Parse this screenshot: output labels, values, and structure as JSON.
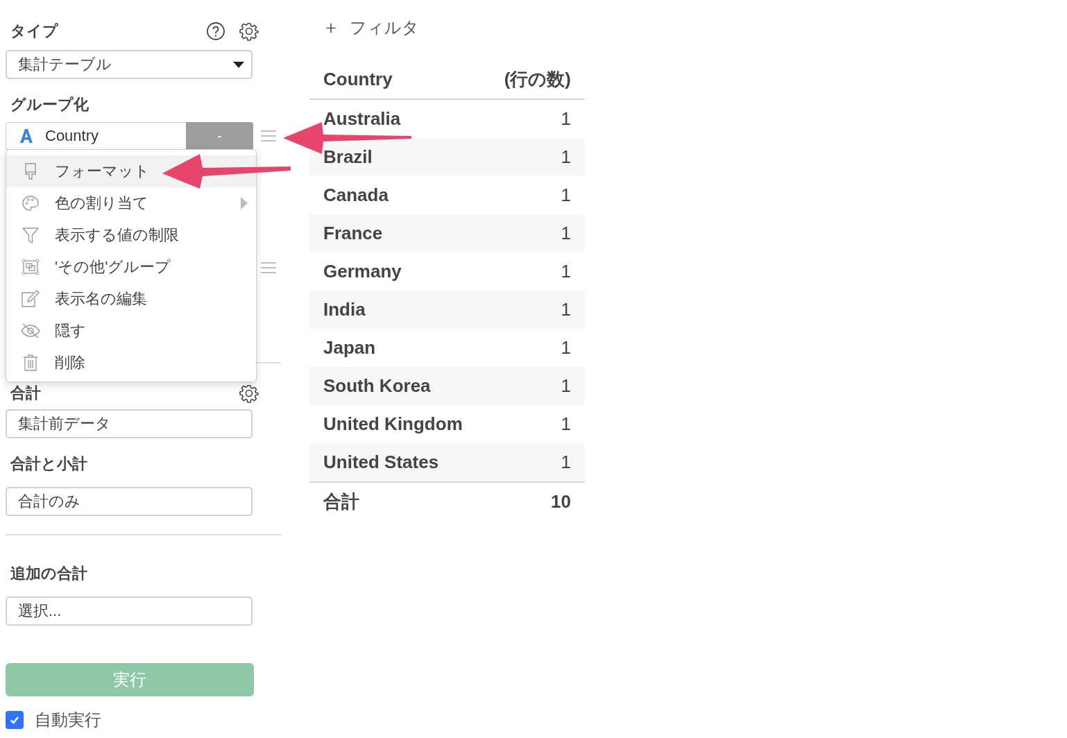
{
  "sidebar": {
    "type_label": "タイプ",
    "type_select": {
      "value": "集計テーブル"
    },
    "group_label": "グループ化",
    "group_field": {
      "name": "Country",
      "remove": "-"
    },
    "menu": {
      "items": [
        {
          "kind": "brush",
          "label": "フォーマット",
          "selected": true,
          "submenu": false
        },
        {
          "kind": "palette",
          "label": "色の割り当て",
          "selected": false,
          "submenu": true
        },
        {
          "kind": "filter",
          "label": "表示する値の制限",
          "selected": false,
          "submenu": false
        },
        {
          "kind": "group",
          "label": "'その他'グループ",
          "selected": false,
          "submenu": false
        },
        {
          "kind": "edit",
          "label": "表示名の編集",
          "selected": false,
          "submenu": false
        },
        {
          "kind": "hide",
          "label": "隠す",
          "selected": false,
          "submenu": false
        },
        {
          "kind": "trash",
          "label": "削除",
          "selected": false,
          "submenu": false
        }
      ]
    },
    "total_label": "合計",
    "total_select": {
      "value": "集計前データ"
    },
    "subtotal_label": "合計と小計",
    "subtotal_select": {
      "value": "合計のみ"
    },
    "extra_label": "追加の合計",
    "extra_select": {
      "placeholder": "選択..."
    },
    "run_button": "実行",
    "auto_run": {
      "label": "自動実行",
      "checked": true
    }
  },
  "filter_button": {
    "icon": "＋",
    "label": "フィルタ"
  },
  "table": {
    "columns": [
      "Country",
      "(行の数)"
    ],
    "rows": [
      [
        "Australia",
        "1"
      ],
      [
        "Brazil",
        "1"
      ],
      [
        "Canada",
        "1"
      ],
      [
        "France",
        "1"
      ],
      [
        "Germany",
        "1"
      ],
      [
        "India",
        "1"
      ],
      [
        "Japan",
        "1"
      ],
      [
        "South Korea",
        "1"
      ],
      [
        "United Kingdom",
        "1"
      ],
      [
        "United States",
        "1"
      ]
    ],
    "total": [
      "合計",
      "10"
    ]
  }
}
